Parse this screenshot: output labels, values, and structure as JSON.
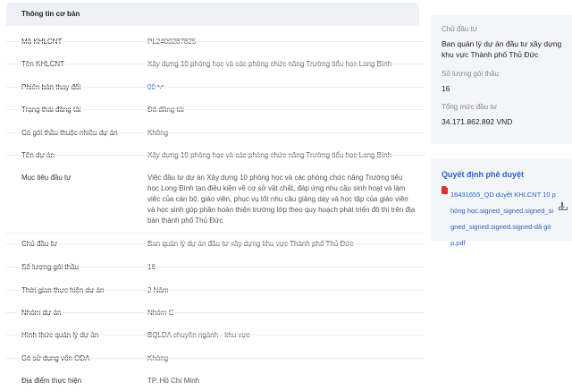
{
  "section_title": "Thông tin cơ bản",
  "fields": [
    {
      "label": "Mã KHLCNT",
      "value": "PL2400287825"
    },
    {
      "label": "Tên KHLCNT",
      "value": "Xây dựng 10 phòng học và các phòng chức năng Trường tiểu học Long Bình"
    },
    {
      "label": "Phiên bản thay đổi",
      "value": "00"
    },
    {
      "label": "Trạng thái đăng tải",
      "value": "Đã đăng tải"
    },
    {
      "label": "Có gói thầu thuộc nhiều dự án",
      "value": "Không"
    },
    {
      "label": "Tên dự án",
      "value": "Xây dựng 10 phòng học và các phòng chức năng Trường tiểu học Long Bình"
    },
    {
      "label": "Mục tiêu đầu tư",
      "value": "Việc đầu tư dự án Xây dựng 10 phòng học và các phòng chức năng Trường tiểu học Long Bình tạo điều kiện về cơ sở vật chất, đáp ứng nhu cầu sinh hoạt và làm việc của cán bộ, giáo viên, phục vụ tốt nhu cầu giảng dạy và học tập của giáo viên và học sinh góp phần hoàn thiện trường lớp theo quy hoạch phát triển đô thị trên địa bàn thành phố Thủ Đức"
    },
    {
      "label": "Chủ đầu tư",
      "value": "Ban quản lý dự án đầu tư xây dựng khu vực Thành phố Thủ Đức"
    },
    {
      "label": "Số lượng gói thầu",
      "value": "16"
    },
    {
      "label": "Thời gian thực hiện dự án",
      "value": "2 Năm"
    },
    {
      "label": "Nhóm dự án",
      "value": "Nhóm C"
    },
    {
      "label": "Hình thức quản lý dự án",
      "value": "BQLDA chuyên ngành - khu vực"
    },
    {
      "label": "Có sử dụng vốn ODA",
      "value": "Không"
    },
    {
      "label": "Địa điểm thực hiện",
      "value": "TP. Hồ Chí Minh"
    }
  ],
  "summary": {
    "investor_label": "Chủ đầu tư",
    "investor_value": "Ban quản lý dự án đầu tư xây dựng khu vực Thành phố Thủ Đức",
    "packages_label": "Số lượng gói thầu",
    "packages_value": "16",
    "total_label": "Tổng mức đầu tư",
    "total_value": "34.171.862.892 VND"
  },
  "decision": {
    "title": "Quyết định phê duyệt",
    "file_name": "16431655_QD duyệt KHLCNT 10 phòng học.signed_signed.signed_signed_signed.signed.signed-dã góp.pdf"
  },
  "icons": {
    "version_dropdown": "chevron-down-icon",
    "file": "pdf-file-icon",
    "download": "download-icon"
  },
  "colors": {
    "accent": "#2a64c8",
    "panel_bg": "#f4f5f7",
    "header_bg": "#eef1f7"
  }
}
